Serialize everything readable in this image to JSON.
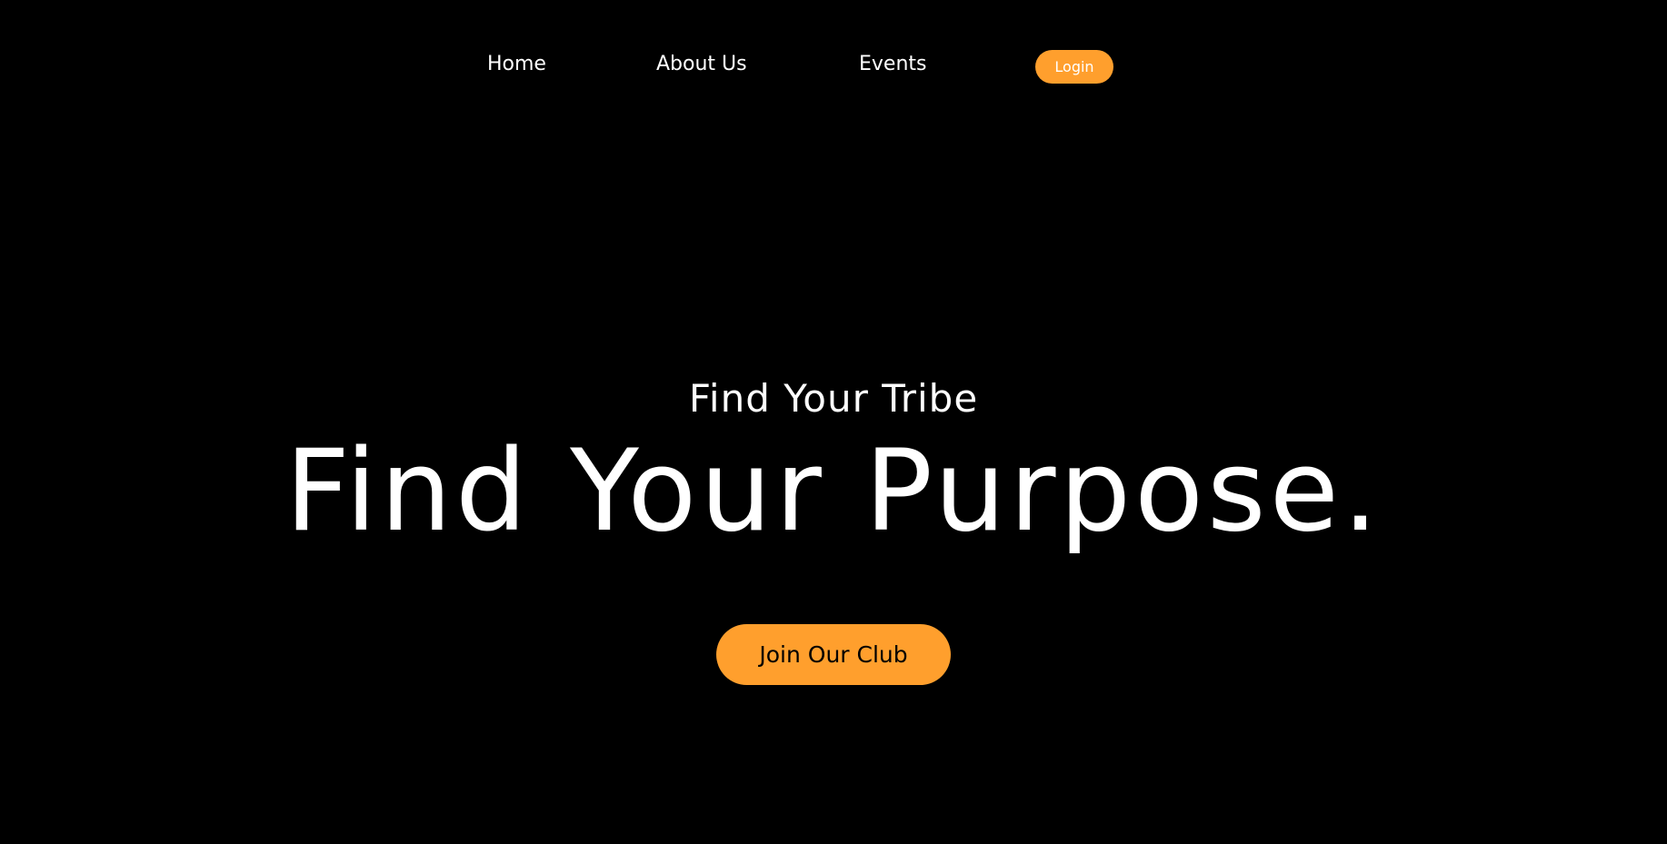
{
  "colors": {
    "background": "#000000",
    "accent": "#ff9f2d",
    "text": "#ffffff",
    "button_text_dark": "#000000"
  },
  "nav": {
    "items": [
      {
        "label": "Home"
      },
      {
        "label": "About Us"
      },
      {
        "label": "Events"
      }
    ],
    "login_label": "Login"
  },
  "hero": {
    "subtitle": "Find Your Tribe",
    "title": "Find Your Purpose.",
    "cta_label": "Join Our Club"
  }
}
